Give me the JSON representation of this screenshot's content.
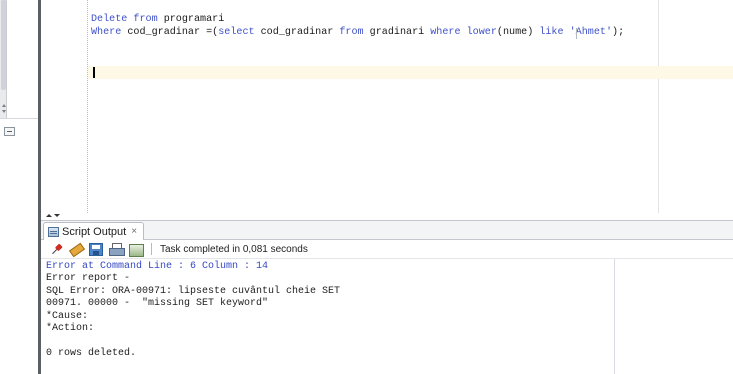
{
  "editor": {
    "lines": [
      {
        "parts": [
          {
            "t": "Delete ",
            "c": "kw"
          },
          {
            "t": "from",
            "c": "kw"
          },
          {
            "t": " programari",
            "c": ""
          }
        ]
      },
      {
        "parts": [
          {
            "t": "Where",
            "c": "kw"
          },
          {
            "t": " cod_gradinar =(",
            "c": ""
          },
          {
            "t": "select",
            "c": "kw"
          },
          {
            "t": " cod_gradinar ",
            "c": ""
          },
          {
            "t": "from",
            "c": "kw"
          },
          {
            "t": " gradinari ",
            "c": ""
          },
          {
            "t": "where",
            "c": "kw"
          },
          {
            "t": " ",
            "c": ""
          },
          {
            "t": "lower",
            "c": "kw"
          },
          {
            "t": "(nume) ",
            "c": ""
          },
          {
            "t": "like",
            "c": "kw"
          },
          {
            "t": " '",
            "c": "str"
          },
          {
            "t": "Ahmet'",
            "c": "str"
          },
          {
            "t": ");",
            "c": ""
          }
        ]
      }
    ]
  },
  "output_panel": {
    "tab_label": "Script Output",
    "tab_close": "×",
    "status": "Task completed in 0,081 seconds",
    "toolbar_icons": [
      "pin-icon",
      "eraser-icon",
      "save-icon",
      "print-icon",
      "clear-icon"
    ],
    "lines": [
      {
        "text": "Error at Command Line : 6 Column : 14",
        "style": "err"
      },
      {
        "text": "Error report -",
        "style": ""
      },
      {
        "text": "SQL Error: ORA-00971: lipseste cuvântul cheie SET",
        "style": ""
      },
      {
        "text": "00971. 00000 -  \"missing SET keyword\"",
        "style": ""
      },
      {
        "text": "*Cause:",
        "style": ""
      },
      {
        "text": "*Action:",
        "style": ""
      },
      {
        "text": "",
        "style": ""
      },
      {
        "text": "0 rows deleted.",
        "style": ""
      }
    ]
  },
  "colors": {
    "keyword": "#3f51c9",
    "current_line_highlight": "#fdf9e6",
    "error_text": "#3648c4"
  }
}
